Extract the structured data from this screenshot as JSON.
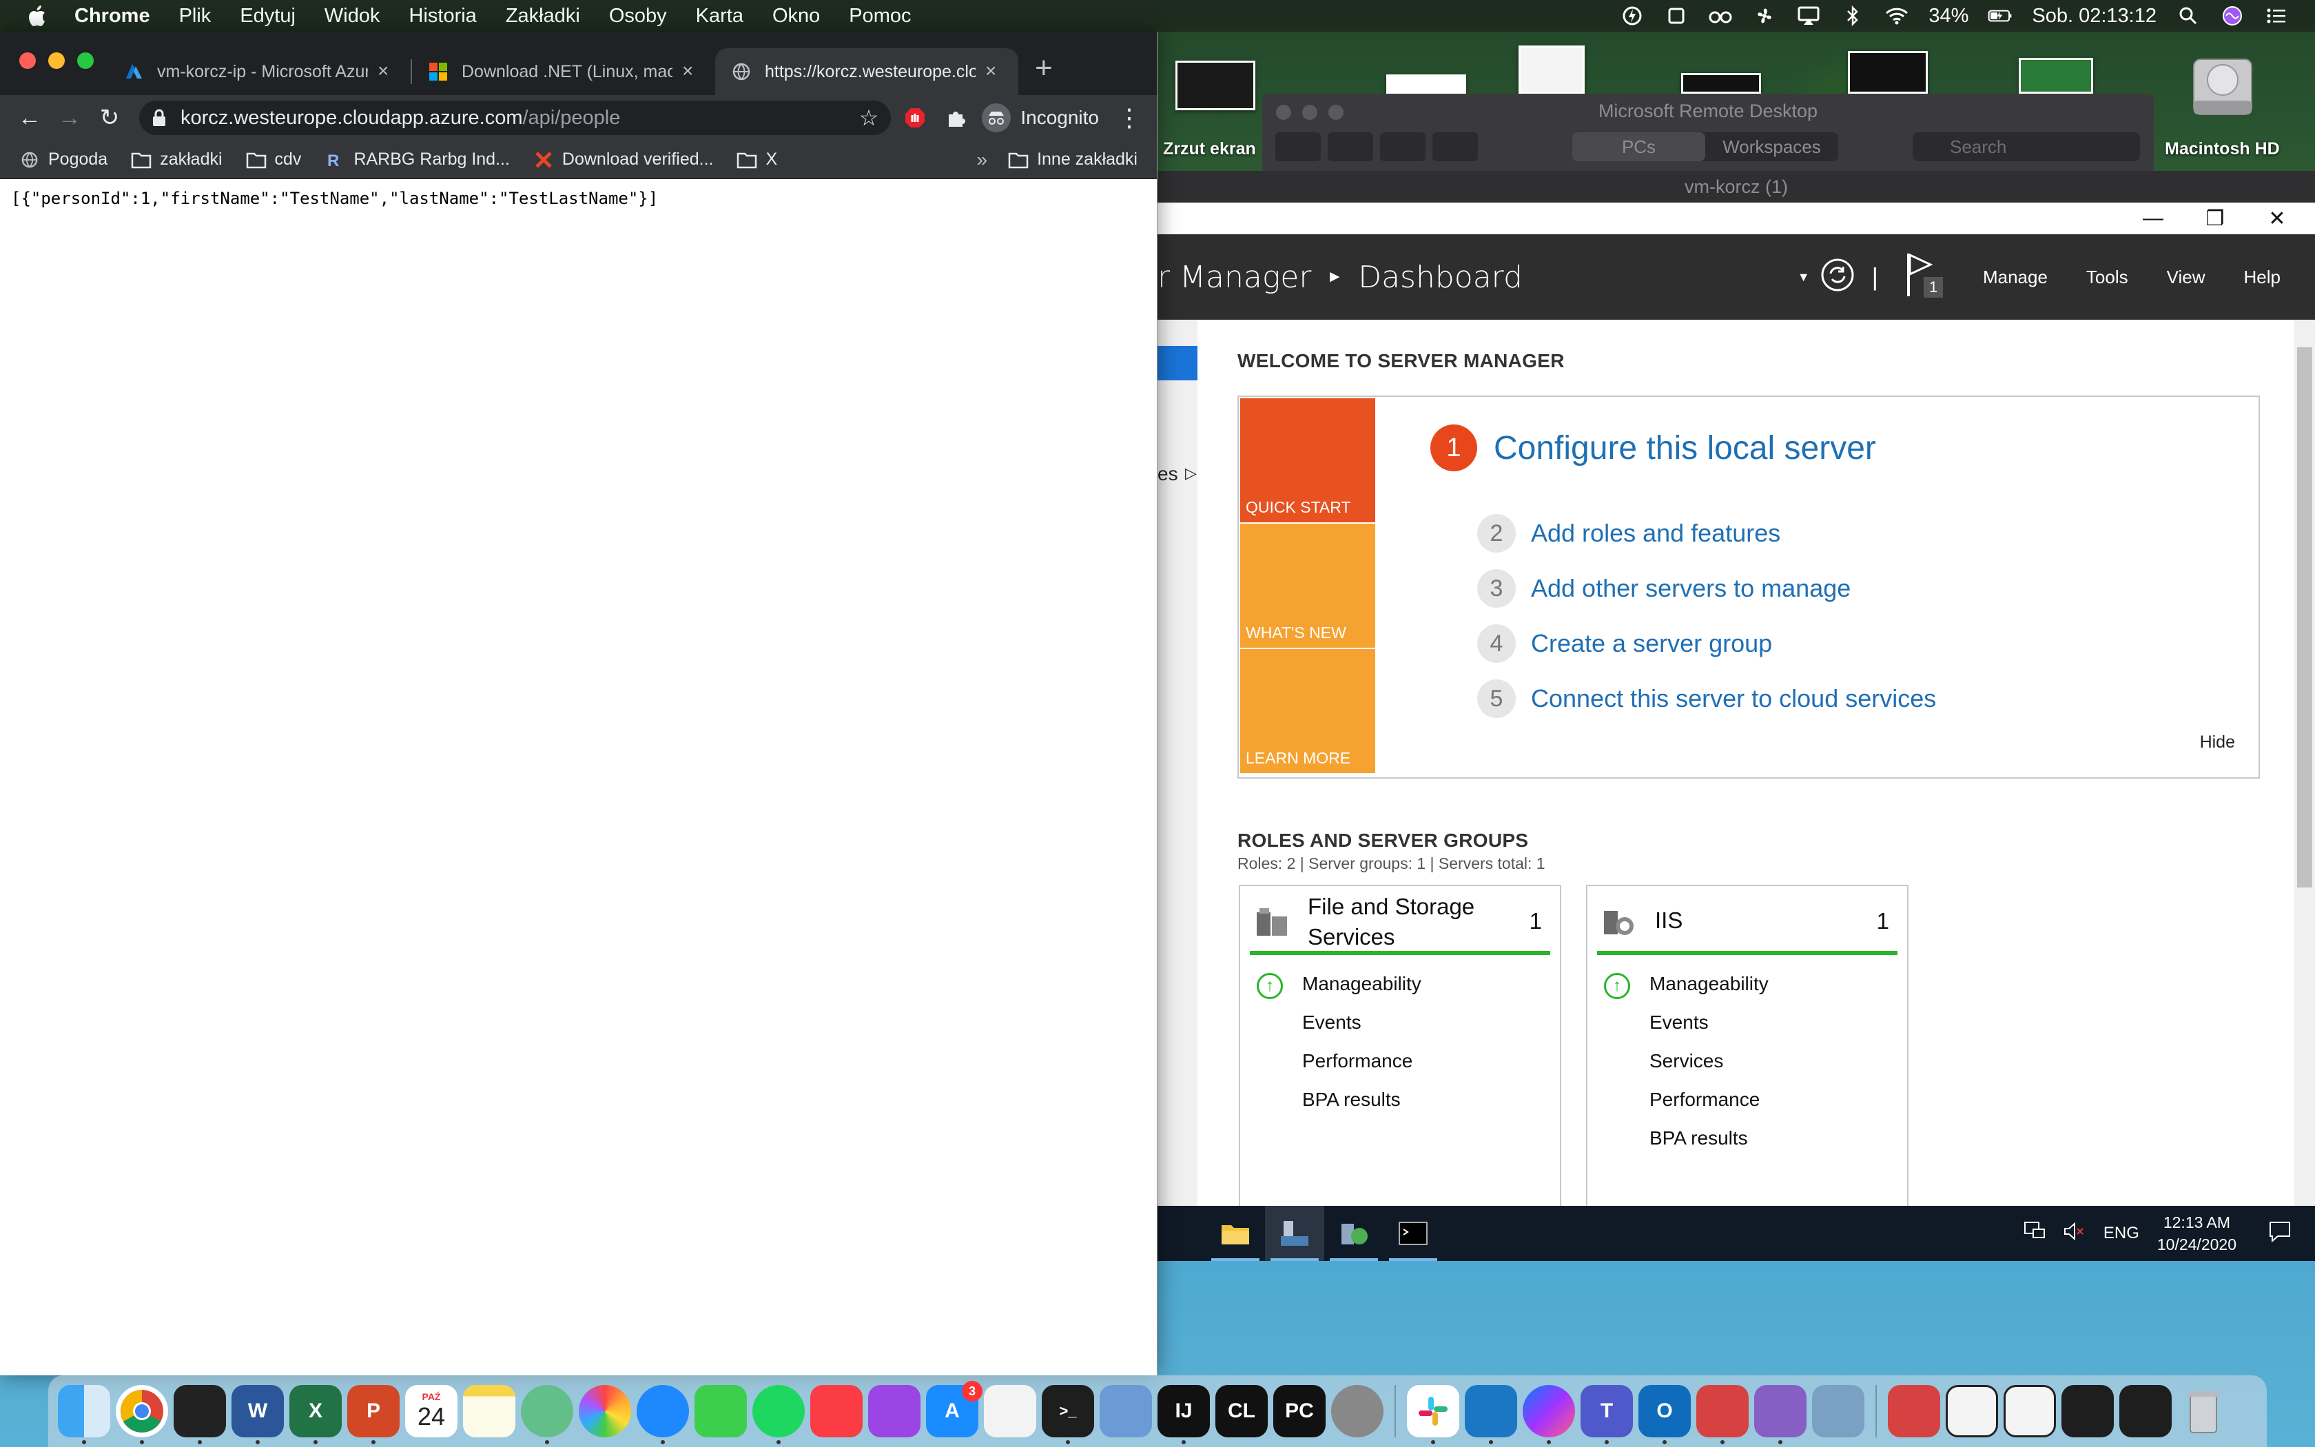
{
  "menubar": {
    "app": "Chrome",
    "items": [
      "Plik",
      "Edytuj",
      "Widok",
      "Historia",
      "Zakładki",
      "Osoby",
      "Karta",
      "Okno",
      "Pomoc"
    ],
    "battery": "34%",
    "clock": "Sob. 02:13:12"
  },
  "chrome": {
    "tabs": [
      {
        "title": "vm-korcz-ip - Microsoft Azure",
        "icon": "azure-icon"
      },
      {
        "title": "Download .NET (Linux, macOS",
        "icon": "microsoft-icon"
      },
      {
        "title": "https://korcz.westeurope.cloudapp",
        "icon": "globe-icon",
        "active": true
      }
    ],
    "address": {
      "host": "korcz.westeurope.cloudapp.azure.com",
      "path": "/api/people"
    },
    "incognito_label": "Incognito",
    "bookmarks": [
      "Pogoda",
      "zakładki",
      "cdv",
      "RARBG Rarbg Ind...",
      "Download verified...",
      "X"
    ],
    "other_bookmarks": "Inne zakładki",
    "page_text": "[{\"personId\":1,\"firstName\":\"TestName\",\"lastName\":\"TestLastName\"}]"
  },
  "desktop": {
    "screenshot_label": "Zrzut ekran",
    "drive_label": "Macintosh HD"
  },
  "remote_desktop_app": {
    "title": "Microsoft Remote Desktop",
    "segments": [
      "PCs",
      "Workspaces"
    ],
    "search_placeholder": "Search",
    "session_title": "vm-korcz (1)"
  },
  "server_manager": {
    "title_prefix": "r Manager",
    "title_page": "Dashboard",
    "menus": [
      "Manage",
      "Tools",
      "View",
      "Help"
    ],
    "flag_count": "1",
    "welcome_title": "WELCOME TO SERVER MANAGER",
    "tiles": [
      "QUICK START",
      "WHAT'S NEW",
      "LEARN MORE"
    ],
    "steps": [
      {
        "num": "1",
        "label": "Configure this local server"
      },
      {
        "num": "2",
        "label": "Add roles and features"
      },
      {
        "num": "3",
        "label": "Add other servers to manage"
      },
      {
        "num": "4",
        "label": "Create a server group"
      },
      {
        "num": "5",
        "label": "Connect this server to cloud services"
      }
    ],
    "hide_label": "Hide",
    "left_partial": "es",
    "roles_title": "ROLES AND SERVER GROUPS",
    "roles_summary": "Roles: 2  |  Server groups: 1  |  Servers total: 1",
    "cards": [
      {
        "name": "File and Storage Services",
        "count": "1",
        "rows": [
          "Manageability",
          "Events",
          "Performance",
          "BPA results"
        ]
      },
      {
        "name": "IIS",
        "count": "1",
        "rows": [
          "Manageability",
          "Events",
          "Services",
          "Performance",
          "BPA results"
        ]
      }
    ]
  },
  "win_taskbar": {
    "lang": "ENG",
    "time": "12:13 AM",
    "date": "10/24/2020"
  },
  "dock": {
    "app_store_badge": "3",
    "calendar_month": "PAŹ",
    "calendar_day": "24"
  },
  "colors": {
    "chrome_dark": "#202124",
    "sm_orange": "#e85120",
    "sm_amber": "#f6a230",
    "sm_link": "#1f6fb4",
    "ok_green": "#2ab52a"
  }
}
